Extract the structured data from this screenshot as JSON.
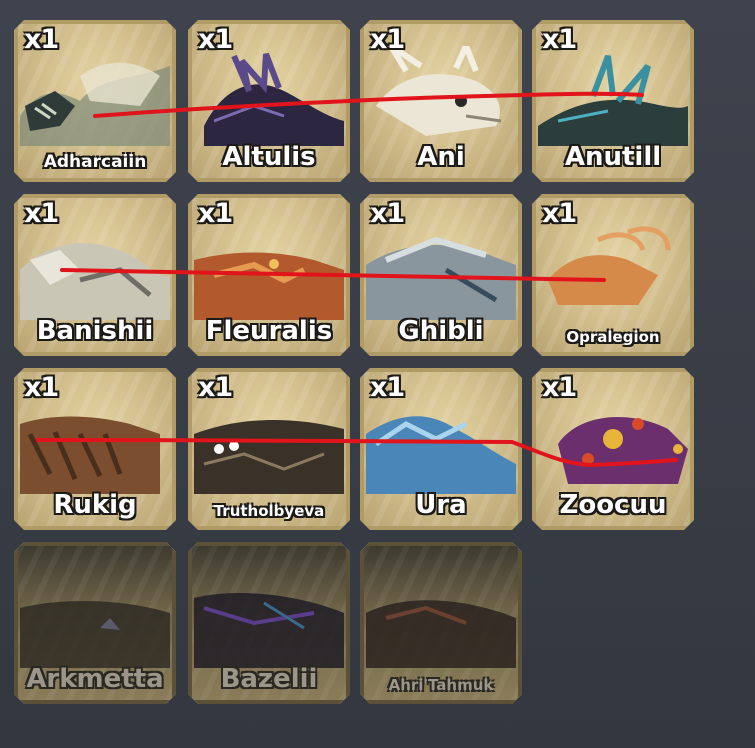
{
  "collection": {
    "cards": [
      {
        "count": "x1",
        "name": "Adharcaiin",
        "locked": false,
        "art": "pale-dragon"
      },
      {
        "count": "x1",
        "name": "Altulis",
        "locked": false,
        "art": "dark-purple-dragon"
      },
      {
        "count": "x1",
        "name": "Ani",
        "locked": false,
        "art": "white-horned-dragon"
      },
      {
        "count": "x1",
        "name": "Anutill",
        "locked": false,
        "art": "teal-finned-dragon"
      },
      {
        "count": "x1",
        "name": "Banishii",
        "locked": false,
        "art": "grey-feathered-dragon"
      },
      {
        "count": "x1",
        "name": "Fleuralis",
        "locked": false,
        "art": "orange-dragon"
      },
      {
        "count": "x1",
        "name": "Ghibli",
        "locked": false,
        "art": "grey-blue-dragon"
      },
      {
        "count": "x1",
        "name": "Opralegion",
        "locked": false,
        "art": "orange-crab-dragon"
      },
      {
        "count": "x1",
        "name": "Rukig",
        "locked": false,
        "art": "brown-shaggy-dragon"
      },
      {
        "count": "x1",
        "name": "Trutholbyeva",
        "locked": false,
        "art": "dark-spotted-dragon"
      },
      {
        "count": "x1",
        "name": "Ura",
        "locked": false,
        "art": "blue-water-dragon"
      },
      {
        "count": "x1",
        "name": "Zoocuu",
        "locked": false,
        "art": "purple-spotted-dragon"
      },
      {
        "count": "",
        "name": "Arkmetta",
        "locked": true,
        "art": "shadow-dragon"
      },
      {
        "count": "",
        "name": "Bazelii",
        "locked": true,
        "art": "shadow-purple-dragon"
      },
      {
        "count": "",
        "name": "Ahri'Tahmuk",
        "locked": true,
        "art": "shadow-rock-dragon"
      }
    ]
  },
  "annotations": {
    "strike_color": "#e0141a"
  },
  "colors": {
    "background": "#3b3f48",
    "card_fill": "#d4c08f",
    "card_border": "#b09b66",
    "text": "#ffffff",
    "text_outline": "#1c1a16"
  }
}
